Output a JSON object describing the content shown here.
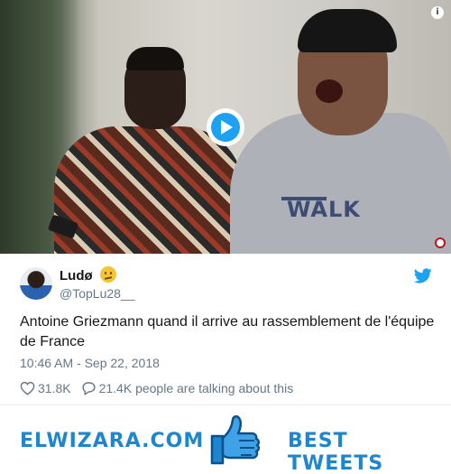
{
  "tweet": {
    "display_name": "Ludø",
    "handle": "@TopLu28__",
    "text": "Antoine Griezmann quand il arrive au rassemblement de l'équipe de France",
    "timestamp": "10:46 AM - Sep 22, 2018",
    "likes": "31.8K",
    "talking": "21.4K people are talking about this"
  },
  "media": {
    "shirt_text": "WALK",
    "info_label": "i"
  },
  "footer": {
    "site_name": "ELWIZARA.COM",
    "tag": "BEST TWEETS"
  },
  "icons": {
    "play": "play-icon",
    "info": "info-icon",
    "bird": "twitter-bird-icon",
    "heart": "heart-icon",
    "comment": "comment-icon",
    "thumb": "thumbs-up-icon",
    "emoji": "confused-face-emoji"
  },
  "colors": {
    "brand_blue": "#1da1f2",
    "footer_blue": "#1e86cf",
    "meta_gray": "#657786"
  }
}
